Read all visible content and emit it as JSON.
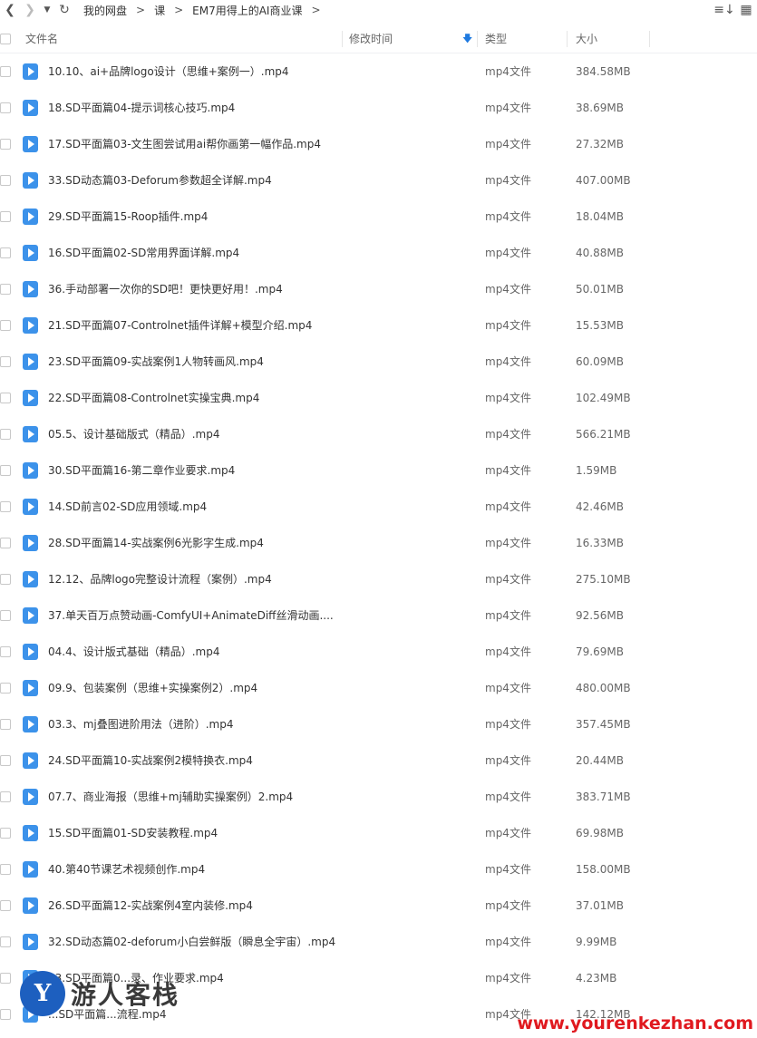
{
  "toolbar": {
    "breadcrumb": [
      "我的网盘",
      "课",
      "EM7用得上的AI商业课"
    ]
  },
  "header": {
    "name": "文件名",
    "modified": "修改时间",
    "type": "类型",
    "size": "大小"
  },
  "files": [
    {
      "name": "10.10、ai+品牌logo设计（思维+案例一）.mp4",
      "type": "mp4文件",
      "size": "384.58MB"
    },
    {
      "name": "18.SD平面篇04-提示词核心技巧.mp4",
      "type": "mp4文件",
      "size": "38.69MB"
    },
    {
      "name": "17.SD平面篇03-文生图尝试用ai帮你画第一幅作品.mp4",
      "type": "mp4文件",
      "size": "27.32MB"
    },
    {
      "name": "33.SD动态篇03-Deforum参数超全详解.mp4",
      "type": "mp4文件",
      "size": "407.00MB"
    },
    {
      "name": "29.SD平面篇15-Roop插件.mp4",
      "type": "mp4文件",
      "size": "18.04MB"
    },
    {
      "name": "16.SD平面篇02-SD常用界面详解.mp4",
      "type": "mp4文件",
      "size": "40.88MB"
    },
    {
      "name": "36.手动部署一次你的SD吧！更快更好用！.mp4",
      "type": "mp4文件",
      "size": "50.01MB"
    },
    {
      "name": "21.SD平面篇07-Controlnet插件详解+模型介绍.mp4",
      "type": "mp4文件",
      "size": "15.53MB"
    },
    {
      "name": "23.SD平面篇09-实战案例1人物转画风.mp4",
      "type": "mp4文件",
      "size": "60.09MB"
    },
    {
      "name": "22.SD平面篇08-Controlnet实操宝典.mp4",
      "type": "mp4文件",
      "size": "102.49MB"
    },
    {
      "name": "05.5、设计基础版式（精品）.mp4",
      "type": "mp4文件",
      "size": "566.21MB"
    },
    {
      "name": "30.SD平面篇16-第二章作业要求.mp4",
      "type": "mp4文件",
      "size": "1.59MB"
    },
    {
      "name": "14.SD前言02-SD应用领域.mp4",
      "type": "mp4文件",
      "size": "42.46MB"
    },
    {
      "name": "28.SD平面篇14-实战案例6光影字生成.mp4",
      "type": "mp4文件",
      "size": "16.33MB"
    },
    {
      "name": "12.12、品牌logo完整设计流程（案例）.mp4",
      "type": "mp4文件",
      "size": "275.10MB"
    },
    {
      "name": "37.单天百万点赞动画-ComfyUI+AnimateDiff丝滑动画....",
      "type": "mp4文件",
      "size": "92.56MB"
    },
    {
      "name": "04.4、设计版式基础（精品）.mp4",
      "type": "mp4文件",
      "size": "79.69MB"
    },
    {
      "name": "09.9、包装案例（思维+实操案例2）.mp4",
      "type": "mp4文件",
      "size": "480.00MB"
    },
    {
      "name": "03.3、mj叠图进阶用法（进阶）.mp4",
      "type": "mp4文件",
      "size": "357.45MB"
    },
    {
      "name": "24.SD平面篇10-实战案例2模特换衣.mp4",
      "type": "mp4文件",
      "size": "20.44MB"
    },
    {
      "name": "07.7、商业海报（思维+mj辅助实操案例）2.mp4",
      "type": "mp4文件",
      "size": "383.71MB"
    },
    {
      "name": "15.SD平面篇01-SD安装教程.mp4",
      "type": "mp4文件",
      "size": "69.98MB"
    },
    {
      "name": "40.第40节课艺术视频创作.mp4",
      "type": "mp4文件",
      "size": "158.00MB"
    },
    {
      "name": "26.SD平面篇12-实战案例4室内装修.mp4",
      "type": "mp4文件",
      "size": "37.01MB"
    },
    {
      "name": "32.SD动态篇02-deforum小白尝鲜版（瞬息全宇宙）.mp4",
      "type": "mp4文件",
      "size": "9.99MB"
    },
    {
      "name": "13.SD平面篇0...录、作业要求.mp4",
      "type": "mp4文件",
      "size": "4.23MB"
    },
    {
      "name": "...SD平面篇...流程.mp4",
      "type": "mp4文件",
      "size": "142.12MB"
    }
  ],
  "watermark": {
    "logo_letter": "Y",
    "logo_text": "游人客栈",
    "url": "www.yourenkezhan.com"
  }
}
